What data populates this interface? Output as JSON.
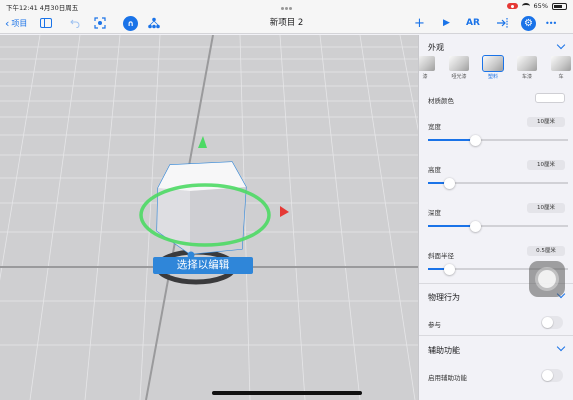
{
  "status_bar": {
    "time_date": "下午12:41  4月30日周五",
    "battery": "65%"
  },
  "toolbar": {
    "back_label": "项目",
    "title": "新项目 2",
    "add_label": "+",
    "play_label": "▶",
    "ar_label": "AR",
    "more_label": "•••"
  },
  "viewport": {
    "hint": "选择以编辑"
  },
  "inspector": {
    "appearance": {
      "title": "外观",
      "materials": [
        "塑料",
        "哑光漆",
        "塑料",
        "车漆",
        "车漆"
      ],
      "selected_material": "塑料",
      "visible_labels": [
        "漆",
        "哑光漆",
        "塑料",
        "车漆",
        "车"
      ],
      "color_label": "材质颜色",
      "width": {
        "label": "宽度",
        "value": "10厘米",
        "level": 0.34
      },
      "height": {
        "label": "高度",
        "value": "10厘米",
        "level": 0.15
      },
      "depth": {
        "label": "深度",
        "value": "10厘米",
        "level": 0.34
      },
      "radius": {
        "label": "斜面半径",
        "value": "0.5厘米",
        "level": 0.15
      }
    },
    "physics": {
      "title": "物理行为",
      "participate_label": "参与"
    },
    "accessibility": {
      "title": "辅助功能",
      "enable_label": "启用辅助功能"
    }
  },
  "colors": {
    "accent": "#1a73e8",
    "hint_bg": "#2f86d9",
    "gizmo_ring": "#4cd964"
  }
}
